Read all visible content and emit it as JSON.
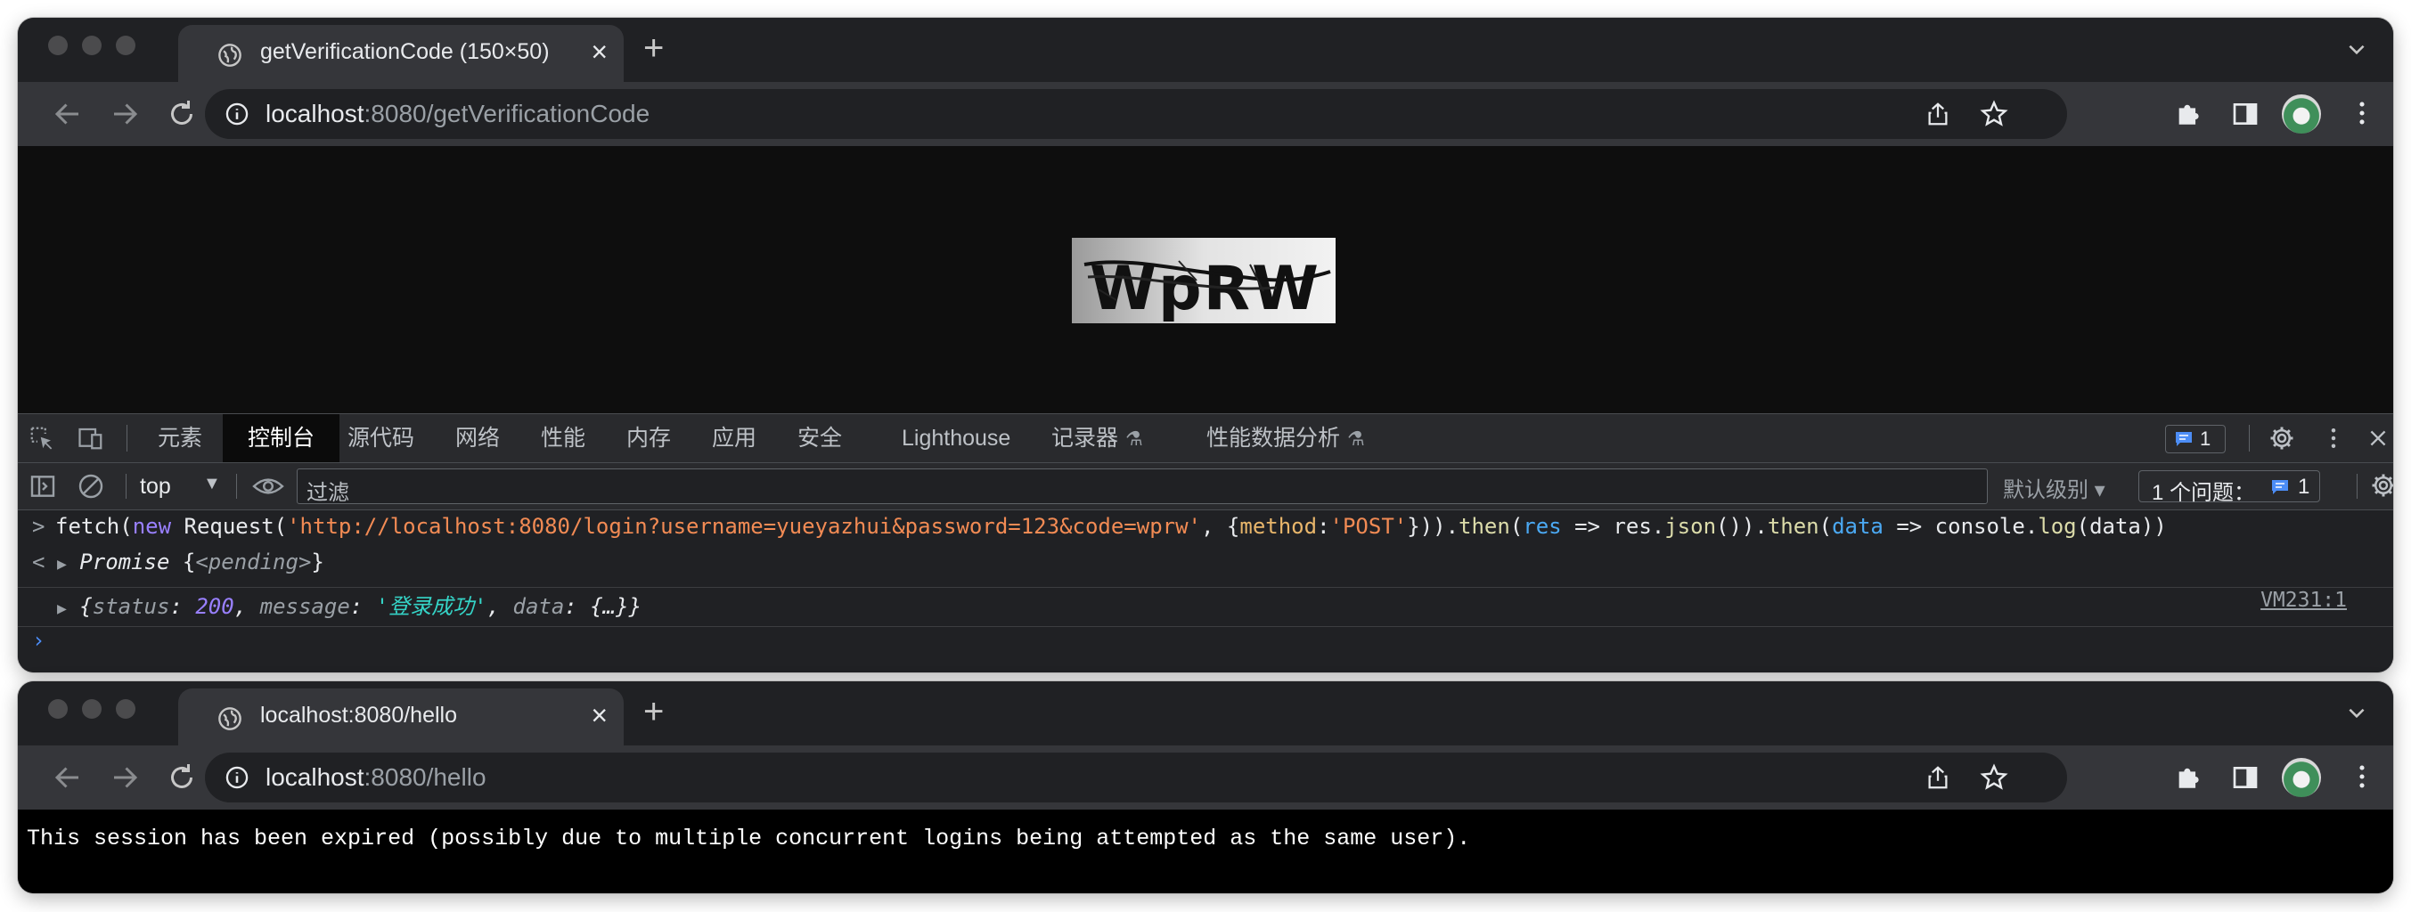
{
  "window1": {
    "tab_title": "getVerificationCode (150×50)",
    "tab_close": "×",
    "new_tab": "+",
    "url_host": "localhost",
    "url_path": ":8080/getVerificationCode",
    "captcha_text": "WpRW"
  },
  "devtools": {
    "tabs": [
      "元素",
      "控制台",
      "源代码",
      "网络",
      "性能",
      "内存",
      "应用",
      "安全",
      "Lighthouse",
      "记录器",
      "性能数据分析"
    ],
    "active_tab": "控制台",
    "flask": "⚗",
    "issue_count": "1",
    "context": "top",
    "context_caret": "▼",
    "filter_placeholder": "过滤",
    "levels_label": "默认级别 ▾",
    "issues_label": "1 个问题：",
    "issues_count": "1",
    "console": {
      "input_marker": ">",
      "cmd": {
        "p1": "fetch(",
        "kw_new": "new",
        "p2": " Request(",
        "url": "'http://localhost:8080/login?username=yueyazhui&password=123&code=wprw'",
        "p3": ", {",
        "key": "method",
        "p4": ":",
        "method": "'POST'",
        "p5": "})).",
        "then1": "then",
        "p6": "(",
        "res": "res",
        "p7": " => res.",
        "json": "json",
        "p8": "()).",
        "then2": "then",
        "p9": "(",
        "data_param": "data",
        "p10": " => console.",
        "log": "log",
        "p11": "(data))"
      },
      "return_marker": "<",
      "promise_arrow": "▶",
      "promise_label": "Promise",
      "promise_open": " {",
      "promise_state": "<pending>",
      "promise_close": "}",
      "result_arrow": "▶",
      "result": {
        "open": "{",
        "k_status": "status",
        "colon1": ": ",
        "v_status": "200",
        "c1": ", ",
        "k_message": "message",
        "colon2": ": ",
        "v_message": "'登录成功'",
        "c2": ", ",
        "k_data": "data",
        "colon3": ": ",
        "v_data": "{…}",
        "close": "}"
      },
      "result_source": "VM231:1",
      "prompt_marker": "›"
    }
  },
  "window2": {
    "tab_title": "localhost:8080/hello",
    "tab_close": "×",
    "new_tab": "+",
    "url_host": "localhost",
    "url_path": ":8080/hello",
    "page_message": "This session has been expired (possibly due to multiple concurrent logins being attempted as the same user)."
  }
}
